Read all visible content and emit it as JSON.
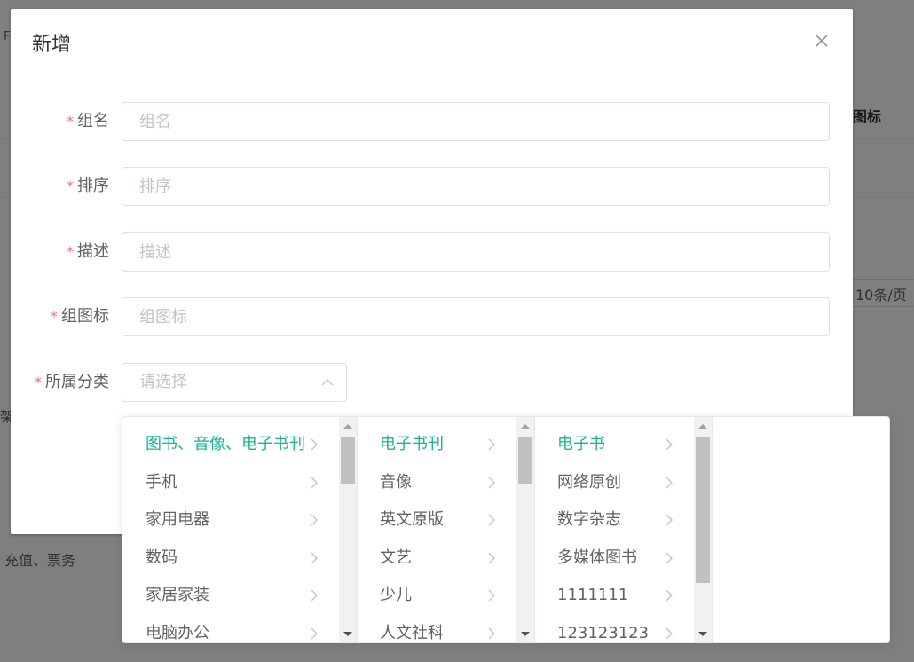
{
  "background": {
    "fragment_top_left": "F",
    "header_icon_col": "图标",
    "pager_size": "10条/页",
    "fragment_left": "架",
    "category_text": "充值、票务"
  },
  "dialog": {
    "title": "新增",
    "close_icon": "close-icon",
    "fields": [
      {
        "label": "组名",
        "placeholder": "组名",
        "required_mark": "*"
      },
      {
        "label": "排序",
        "placeholder": "排序",
        "required_mark": "*"
      },
      {
        "label": "描述",
        "placeholder": "描述",
        "required_mark": "*"
      },
      {
        "label": "组图标",
        "placeholder": "组图标",
        "required_mark": "*"
      }
    ],
    "category": {
      "label": "所属分类",
      "placeholder": "请选择",
      "required_mark": "*"
    }
  },
  "cascader": {
    "accent_color": "#1ab394",
    "columns": [
      {
        "items": [
          "图书、音像、电子书刊",
          "手机",
          "家用电器",
          "数码",
          "家居家装",
          "电脑办公"
        ],
        "active_index": 0,
        "scroll_thumb_fraction": 0.25
      },
      {
        "items": [
          "电子书刊",
          "音像",
          "英文原版",
          "文艺",
          "少儿",
          "人文社科"
        ],
        "active_index": 0,
        "scroll_thumb_fraction": 0.25
      },
      {
        "items": [
          "电子书",
          "网络原创",
          "数字杂志",
          "多媒体图书",
          "1111111",
          "123123123"
        ],
        "active_index": 0,
        "scroll_thumb_fraction": 0.78
      }
    ]
  }
}
